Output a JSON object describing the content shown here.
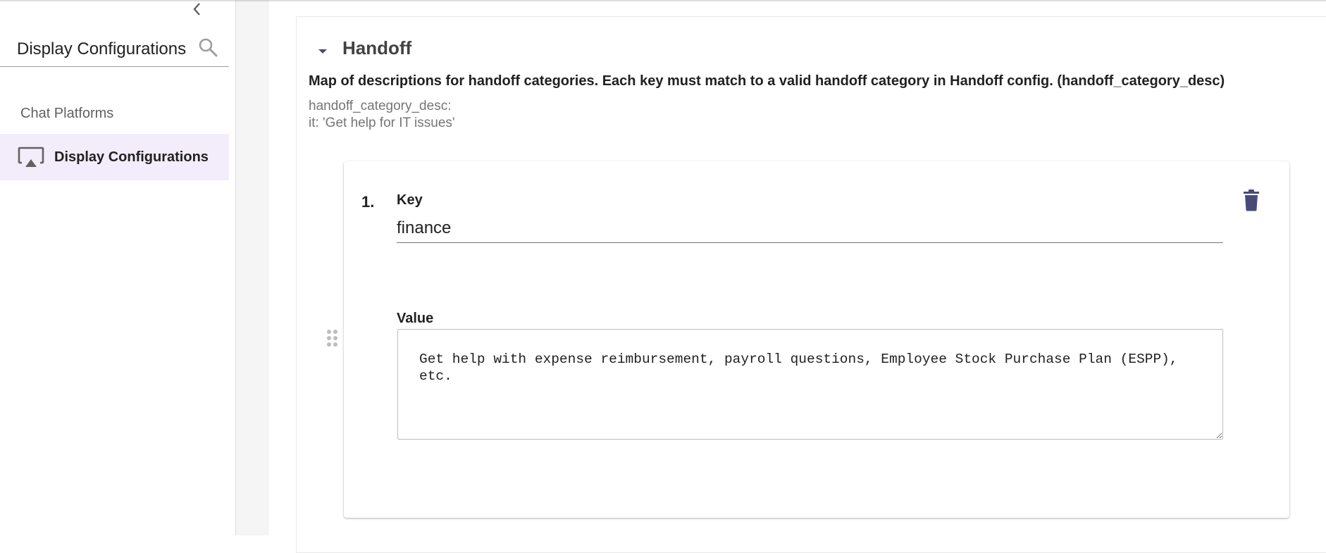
{
  "sidebar": {
    "search": {
      "value": "Display Configurations"
    },
    "section_label": "Chat Platforms",
    "items": [
      {
        "label": "Display Configurations",
        "icon": "screen-cast-icon",
        "selected": true
      }
    ]
  },
  "main": {
    "section": {
      "title": "Handoff",
      "expanded": true,
      "description": "Map of descriptions for handoff categories. Each key must match to a valid handoff category in Handoff config. (handoff_category_desc)",
      "example_lines": [
        "handoff_category_desc:",
        "it: 'Get help for IT issues'"
      ],
      "entries": [
        {
          "index": "1.",
          "key_label": "Key",
          "key_value": "finance",
          "value_label": "Value",
          "value_text": "Get help with expense reimbursement, payroll questions, Employee Stock Purchase Plan (ESPP), etc."
        }
      ]
    }
  },
  "colors": {
    "accent_icon": "#4a4a7a",
    "selected_bg": "#f3ecfb",
    "gutter_bg": "#f5f5f5"
  }
}
